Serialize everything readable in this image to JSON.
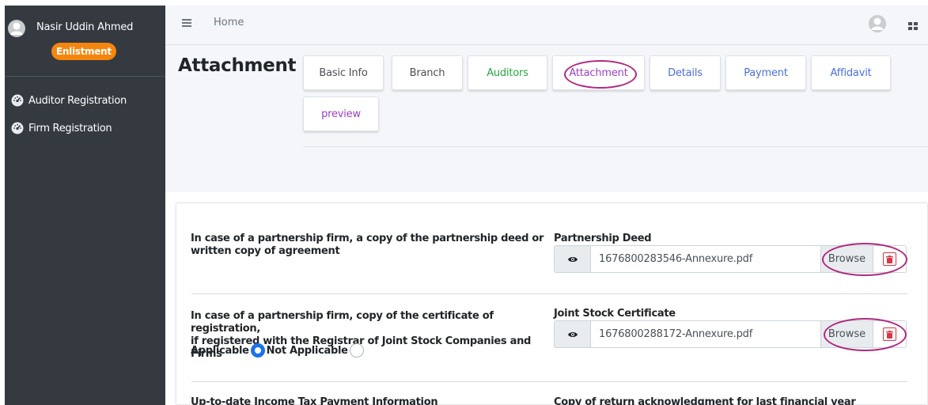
{
  "sidebar": {
    "user_name": "Nasir Uddin Ahmed",
    "badge": "Enlistment",
    "items": [
      {
        "label": "Auditor Registration",
        "icon": "dashboard-gauge-icon"
      },
      {
        "label": "Firm Registration",
        "icon": "dashboard-gauge-icon"
      }
    ]
  },
  "header": {
    "home_label": "Home"
  },
  "page": {
    "title": "Attachment"
  },
  "tabs": [
    {
      "label": "Basic Info",
      "color": "#495057"
    },
    {
      "label": "Branch",
      "color": "#495057"
    },
    {
      "label": "Auditors",
      "color": "#28a745"
    },
    {
      "label": "Attachment",
      "color": "#9c3fc0"
    },
    {
      "label": "Details",
      "color": "#4a6fd8"
    },
    {
      "label": "Payment",
      "color": "#4a6fd8"
    },
    {
      "label": "Affidavit",
      "color": "#4a6fd8"
    },
    {
      "label": "preview",
      "color": "#9c3fc0"
    }
  ],
  "attachments": [
    {
      "description": "In case of a partnership firm, a copy of the partnership deed or written copy of agreement",
      "description_lines": [
        "In case of a partnership firm, a copy of the partnership deed or",
        "written copy of agreement"
      ],
      "field_label": "Partnership Deed",
      "file_name": "1676800283546-Annexure.pdf",
      "browse_label": "Browse"
    },
    {
      "description_lines": [
        "In case of a partnership firm, copy of the certificate of registration,",
        "if registered with the Registrar of Joint Stock Companies and Firms"
      ],
      "field_label": "Joint Stock Certificate",
      "file_name": "1676800288172-Annexure.pdf",
      "browse_label": "Browse",
      "applicable_label": "Applicable",
      "not_applicable_label": "Not Applicable",
      "selected": "Applicable"
    },
    {
      "description_lines": [
        "Up-to-date Income Tax Payment Information"
      ],
      "field_label": "Copy of return acknowledgment for last financial year"
    }
  ],
  "colors": {
    "sidebar_bg": "#343a40",
    "badge_bg": "#f5860d",
    "highlight_ellipse": "#b0287f",
    "radio_checked": "#1a73e8",
    "trash_red": "#dc3545"
  }
}
